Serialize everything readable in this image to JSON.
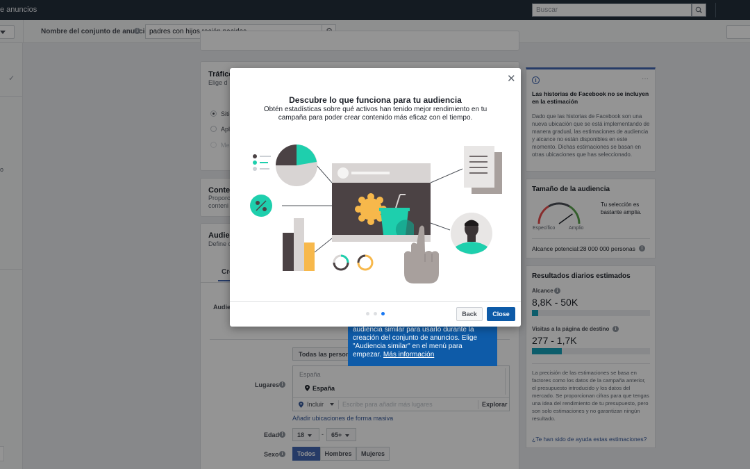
{
  "topbar": {
    "title": "e anuncios",
    "search_placeholder": "Buscar"
  },
  "subbar": {
    "adset_label": "Nombre del conjunto de anuncios",
    "adset_name": "padres con hijos recién nacidos"
  },
  "leftrail": {
    "fragment": "o"
  },
  "center": {
    "traffic_card": {
      "title": "Tráfico",
      "subtitle": "Elige d",
      "options": [
        "Sitio",
        "Apli",
        "Mes"
      ]
    },
    "content_card": {
      "title": "Conte",
      "subtitle_1": "Proporc",
      "subtitle_2": "conteni"
    },
    "audience_card": {
      "title": "Audie",
      "subtitle": "Define q",
      "tab": "Cre",
      "field_audience": "Audie"
    },
    "tooltip": {
      "text": "audiencia similar para usarlo durante la creación del conjunto de anuncios. Elige \"Audiencia similar\" en el menú para empezar.",
      "link": "Más información"
    },
    "audience_button": "Todas las personas",
    "locations": {
      "label": "Lugares",
      "country_header": "España",
      "location": "España",
      "include": "Incluir",
      "placeholder": "Escribe para añadir más lugares",
      "explore": "Explorar"
    },
    "bulk_link": "Añadir ubicaciones de forma masiva",
    "age": {
      "label": "Edad",
      "min": "18",
      "dash": "-",
      "max": "65+"
    },
    "gender": {
      "label": "Sexo",
      "options": [
        "Todos",
        "Hombres",
        "Mujeres"
      ],
      "selected": "Todos"
    }
  },
  "right": {
    "notice": {
      "title": "Las historias de Facebook no se incluyen en la estimación",
      "body": "Dado que las historias de Facebook son una nueva ubicación que se está implementando de manera gradual, las estimaciones de audiencia y alcance no están disponibles en este momento. Dichas estimaciones se basan en otras ubicaciones que has seleccionado.",
      "more": "···"
    },
    "audience_size": {
      "title": "Tamaño de la audiencia",
      "verdict": "Tu selección es bastante amplia.",
      "specific": "Específico",
      "broad": "Amplio",
      "reach": "Alcance potencial:28 000 000 personas",
      "gauge_level": 0.8
    },
    "daily": {
      "title": "Resultados diarios estimados",
      "reach_label": "Alcance",
      "reach_value": "8,8K - 50K",
      "reach_fill": 0.05,
      "visits_label": "Visitas a la página de destino",
      "visits_value": "277 - 1,7K",
      "visits_fill": 0.25,
      "disclaimer": "La precisión de las estimaciones se basa en factores como los datos de la campaña anterior, el presupuesto introducido y los datos del mercado. Se proporcionan cifras para que tengas una idea del rendimiento de tu presupuesto, pero son solo estimaciones y no garantizan ningún resultado.",
      "help_link": "¿Te han sido de ayuda estas estimaciones?"
    }
  },
  "modal": {
    "title": "Descubre lo que funciona para tu audiencia",
    "description": "Obtén estadísticas sobre qué activos han tenido mejor rendimiento en tu campaña para poder crear contenido más eficaz con el tiempo.",
    "back": "Back",
    "close": "Close",
    "page_dots": 3,
    "current_page": 3
  },
  "colors": {
    "accent": "#0e5ba8",
    "teal": "#1ecfad",
    "dark": "#4b4244",
    "orange": "#f7b84b",
    "bar_fill": "#15a1b8"
  }
}
